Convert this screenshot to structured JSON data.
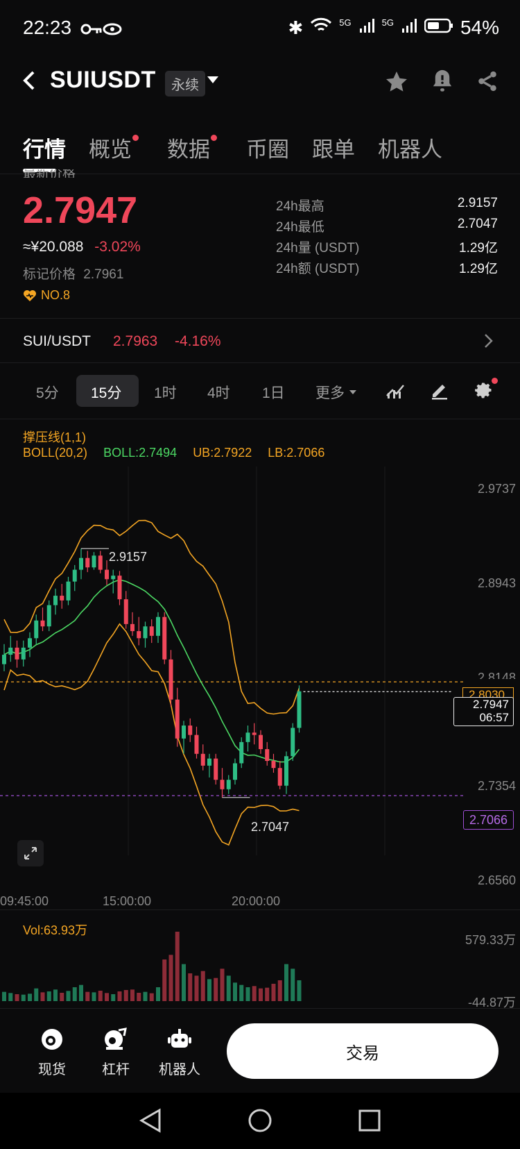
{
  "status_bar": {
    "time": "22:23",
    "battery": "54%",
    "network_1": "5G",
    "network_2": "5G"
  },
  "header": {
    "symbol": "SUIUSDT",
    "contract_tag": "永续"
  },
  "tabs": [
    {
      "label": "行情",
      "active": true,
      "dot": false
    },
    {
      "label": "概览",
      "active": false,
      "dot": true
    },
    {
      "label": "数据",
      "active": false,
      "dot": true
    },
    {
      "label": "币圈",
      "active": false,
      "dot": false
    },
    {
      "label": "跟单",
      "active": false,
      "dot": false
    },
    {
      "label": "机器人",
      "active": false,
      "dot": false
    }
  ],
  "price": {
    "latest_label": "最新价格",
    "last": "2.7947",
    "cny": "≈¥20.088",
    "change": "-3.02%",
    "mark_label": "标记价格",
    "mark_value": "2.7961",
    "rank": "NO.8"
  },
  "stats": [
    {
      "label": "24h最高",
      "value": "2.9157"
    },
    {
      "label": "24h最低",
      "value": "2.7047"
    },
    {
      "label": "24h量 (USDT)",
      "value": "1.29亿"
    },
    {
      "label": "24h额 (USDT)",
      "value": "1.29亿"
    }
  ],
  "spot": {
    "pair": "SUI/USDT",
    "price": "2.7963",
    "change": "-4.16%"
  },
  "periods": [
    "5分",
    "15分",
    "1时",
    "4时",
    "1日",
    "更多"
  ],
  "active_period": "15分",
  "indicators": {
    "line1": "撑压线(1,1)",
    "boll_params": "BOLL(20,2)",
    "boll_mid": "BOLL:2.7494",
    "boll_ub": "UB:2.7922",
    "boll_lb": "LB:2.7066"
  },
  "chart_labels": {
    "high": "2.9157",
    "low": "2.7047",
    "current_price": "2.7947",
    "countdown": "06:57",
    "ub_tag": "2.8030",
    "lb_tag": "2.7066"
  },
  "chart_data": {
    "type": "candlestick",
    "ylim": [
      2.656,
      2.9737
    ],
    "y_ticks": [
      "2.9737",
      "2.8943",
      "2.8148",
      "2.7354",
      "2.6560"
    ],
    "x_ticks": [
      "09:45:00",
      "15:00:00",
      "20:00:00"
    ],
    "volume": {
      "label": "Vol:63.93万",
      "max_label": "579.33万",
      "min_label": "-44.87万"
    },
    "candles": [
      [
        2.818,
        2.835,
        2.812,
        2.826
      ],
      [
        2.826,
        2.842,
        2.82,
        2.832
      ],
      [
        2.832,
        2.838,
        2.815,
        2.822
      ],
      [
        2.822,
        2.838,
        2.816,
        2.832
      ],
      [
        2.832,
        2.845,
        2.824,
        2.84
      ],
      [
        2.84,
        2.86,
        2.835,
        2.855
      ],
      [
        2.855,
        2.866,
        2.846,
        2.85
      ],
      [
        2.85,
        2.872,
        2.846,
        2.868
      ],
      [
        2.868,
        2.882,
        2.86,
        2.876
      ],
      [
        2.876,
        2.886,
        2.865,
        2.872
      ],
      [
        2.872,
        2.892,
        2.868,
        2.888
      ],
      [
        2.888,
        2.902,
        2.88,
        2.898
      ],
      [
        2.898,
        2.916,
        2.89,
        2.908
      ],
      [
        2.908,
        2.914,
        2.896,
        2.9
      ],
      [
        2.9,
        2.913,
        2.898,
        2.91
      ],
      [
        2.91,
        2.914,
        2.895,
        2.898
      ],
      [
        2.898,
        2.906,
        2.885,
        2.89
      ],
      [
        2.89,
        2.898,
        2.878,
        2.893
      ],
      [
        2.893,
        2.897,
        2.868,
        2.873
      ],
      [
        2.873,
        2.88,
        2.848,
        2.852
      ],
      [
        2.852,
        2.862,
        2.842,
        2.846
      ],
      [
        2.846,
        2.858,
        2.834,
        2.84
      ],
      [
        2.84,
        2.854,
        2.832,
        2.85
      ],
      [
        2.85,
        2.856,
        2.836,
        2.842
      ],
      [
        2.842,
        2.862,
        2.836,
        2.858
      ],
      [
        2.858,
        2.862,
        2.818,
        2.822
      ],
      [
        2.822,
        2.83,
        2.782,
        2.788
      ],
      [
        2.788,
        2.798,
        2.748,
        2.755
      ],
      [
        2.755,
        2.77,
        2.742,
        2.766
      ],
      [
        2.766,
        2.772,
        2.752,
        2.758
      ],
      [
        2.758,
        2.765,
        2.738,
        2.742
      ],
      [
        2.742,
        2.75,
        2.728,
        2.732
      ],
      [
        2.732,
        2.742,
        2.722,
        2.738
      ],
      [
        2.738,
        2.742,
        2.716,
        2.72
      ],
      [
        2.72,
        2.73,
        2.705,
        2.712
      ],
      [
        2.712,
        2.724,
        2.708,
        2.72
      ],
      [
        2.72,
        2.738,
        2.716,
        2.734
      ],
      [
        2.734,
        2.756,
        2.73,
        2.752
      ],
      [
        2.752,
        2.766,
        2.744,
        2.76
      ],
      [
        2.76,
        2.768,
        2.75,
        2.758
      ],
      [
        2.758,
        2.762,
        2.742,
        2.746
      ],
      [
        2.746,
        2.752,
        2.732,
        2.736
      ],
      [
        2.736,
        2.742,
        2.726,
        2.73
      ],
      [
        2.73,
        2.736,
        2.712,
        2.715
      ],
      [
        2.715,
        2.744,
        2.708,
        2.74
      ],
      [
        2.74,
        2.768,
        2.736,
        2.764
      ],
      [
        2.764,
        2.8,
        2.76,
        2.795
      ]
    ],
    "volumes": [
      40,
      35,
      30,
      28,
      32,
      55,
      38,
      42,
      50,
      36,
      44,
      60,
      70,
      40,
      38,
      45,
      35,
      30,
      42,
      48,
      50,
      36,
      40,
      34,
      60,
      180,
      200,
      300,
      160,
      120,
      110,
      130,
      95,
      100,
      140,
      110,
      80,
      70,
      60,
      65,
      55,
      58,
      75,
      90,
      160,
      140,
      90
    ]
  },
  "bottom_nav": [
    {
      "label": "现货"
    },
    {
      "label": "杠杆"
    },
    {
      "label": "机器人"
    }
  ],
  "trade_button": "交易"
}
